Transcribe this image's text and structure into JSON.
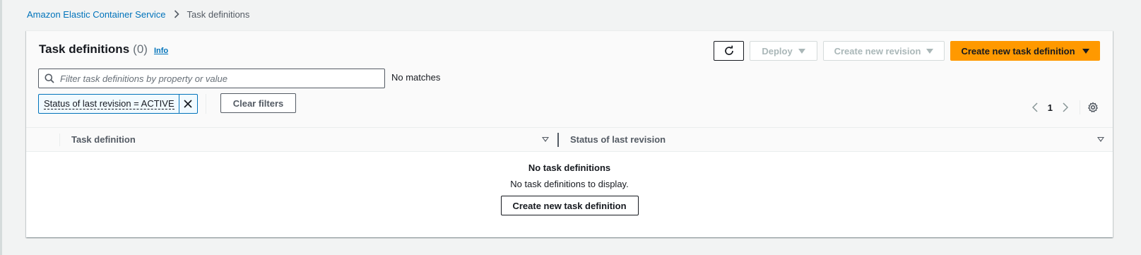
{
  "breadcrumb": {
    "service_label": "Amazon Elastic Container Service",
    "current_label": "Task definitions"
  },
  "header": {
    "title": "Task definitions",
    "count": "(0)",
    "info_label": "Info"
  },
  "actions": {
    "refresh_icon": "refresh-icon",
    "deploy_label": "Deploy",
    "create_revision_label": "Create new revision",
    "create_task_def_label": "Create new task definition"
  },
  "filter": {
    "placeholder": "Filter task definitions by property or value",
    "value": "",
    "match_status": "No matches",
    "token_label": "Status of last revision = ACTIVE",
    "clear_filters_label": "Clear filters"
  },
  "pagination": {
    "current_page": "1"
  },
  "table": {
    "columns": [
      {
        "label": "Task definition"
      },
      {
        "label": "Status of last revision"
      }
    ],
    "rows": []
  },
  "empty_state": {
    "title": "No task definitions",
    "description": "No task definitions to display.",
    "action_label": "Create new task definition"
  },
  "colors": {
    "primary_button": "#ff9900",
    "link": "#0073bb",
    "background": "#f2f3f3"
  }
}
